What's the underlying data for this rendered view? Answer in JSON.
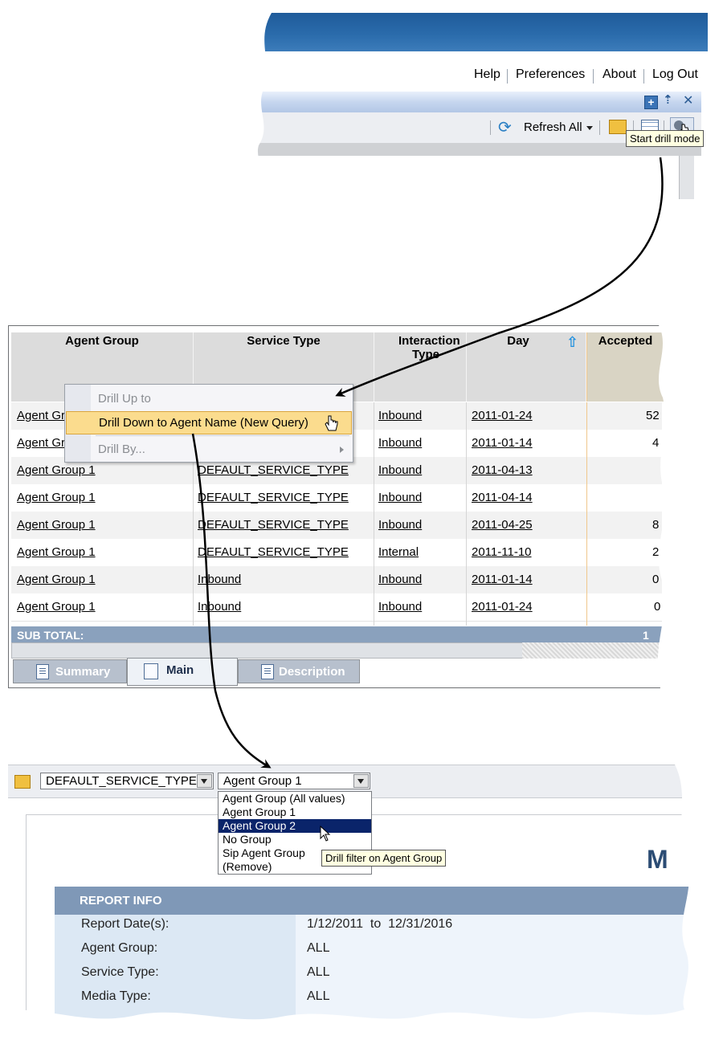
{
  "top_panel": {
    "nav_links": [
      "Help",
      "Preferences",
      "About",
      "Log Out"
    ],
    "toolbar": {
      "refresh_label": "Refresh All"
    },
    "tooltip": "Start drill mode"
  },
  "table_panel": {
    "columns": [
      "Agent Group",
      "Service Type",
      "Interaction Type",
      "Day",
      "Accepted"
    ],
    "rows": [
      {
        "agent_group": "Agent Gro",
        "service_type": "",
        "interaction_type": "Inbound",
        "day": "2011-01-24",
        "accepted": "52"
      },
      {
        "agent_group": "Agent Gro",
        "service_type": "",
        "interaction_type": "Inbound",
        "day": "2011-01-14",
        "accepted": "4"
      },
      {
        "agent_group": "Agent Group 1",
        "service_type": "DEFAULT_SERVICE_TYPE",
        "interaction_type": "Inbound",
        "day": "2011-04-13",
        "accepted": ""
      },
      {
        "agent_group": "Agent Group 1",
        "service_type": "DEFAULT_SERVICE_TYPE",
        "interaction_type": "Inbound",
        "day": "2011-04-14",
        "accepted": ""
      },
      {
        "agent_group": "Agent Group 1",
        "service_type": "DEFAULT_SERVICE_TYPE",
        "interaction_type": "Inbound",
        "day": "2011-04-25",
        "accepted": "8"
      },
      {
        "agent_group": "Agent Group 1",
        "service_type": "DEFAULT_SERVICE_TYPE",
        "interaction_type": "Internal",
        "day": "2011-11-10",
        "accepted": "2"
      },
      {
        "agent_group": "Agent Group 1",
        "service_type": "Inbound",
        "interaction_type": "Inbound",
        "day": "2011-01-14",
        "accepted": "0"
      },
      {
        "agent_group": "Agent Group 1",
        "service_type": "Inbound",
        "interaction_type": "Inbound",
        "day": "2011-01-24",
        "accepted": "0"
      }
    ],
    "subtotal_label": "SUB TOTAL:",
    "subtotal_value": "1",
    "context_menu": [
      "Drill Up to",
      "Drill Down to Agent Name (New Query)",
      "Drill By..."
    ],
    "tabs": [
      "Summary",
      "Main",
      "Description"
    ]
  },
  "filter_panel": {
    "service_type_combo": "DEFAULT_SERVICE_TYPE",
    "agent_group_combo": "Agent Group 1",
    "dropdown_options": [
      "Agent Group (All values)",
      "Agent Group 1",
      "Agent Group 2",
      "No Group",
      "Sip Agent Group",
      "(Remove)"
    ],
    "tooltip": "Drill filter on Agent Group",
    "title_fragment": "M",
    "report_info": {
      "header": "REPORT INFO",
      "rows": [
        {
          "label": "Report Date(s):",
          "value": "1/12/2011  to  12/31/2016"
        },
        {
          "label": "Agent Group:",
          "value": "ALL"
        },
        {
          "label": "Service Type:",
          "value": "ALL"
        },
        {
          "label": "Media Type:",
          "value": "ALL"
        }
      ],
      "partial_value": "ALL"
    }
  },
  "colors": {
    "banner": "#2a6bab",
    "subtotal_bar": "#8aa1bd",
    "dropdown_selected": "#0a246a",
    "report_header": "#7f98b7"
  }
}
